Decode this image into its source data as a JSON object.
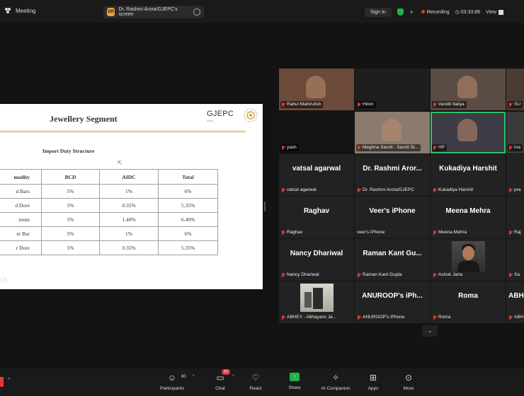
{
  "topbar": {
    "app_title": "Meeting",
    "share_badge": "DR",
    "share_label": "Dr. Rashmi Arora/GJEPC's screen",
    "signin": "Sign In",
    "recording": "Recording",
    "timer": "03:33:89",
    "view": "View"
  },
  "slide": {
    "title": "Jewellery Segment",
    "logo": "GJEPC",
    "logo_sub": "INDIA",
    "subtitle": "Import Duty Structure",
    "table": {
      "headers": [
        "modity",
        "BCD",
        "AIDC",
        "Total"
      ],
      "rows": [
        [
          "d Bars",
          "5%",
          "1%",
          "6%"
        ],
        [
          "d Dore",
          "5%",
          "0.35%",
          "5.35%"
        ],
        [
          "inum",
          "5%",
          "1.40%",
          "6.40%"
        ],
        [
          "er Bar",
          "5%",
          "1%",
          "6%"
        ],
        [
          "r Dore",
          "5%",
          "0.35%",
          "5.35%"
        ]
      ]
    },
    "slide_number": "08"
  },
  "gallery": {
    "video_tiles": [
      {
        "caption": "Rahul Mahirulish",
        "col": 0,
        "row": 0
      },
      {
        "caption": "Hiren",
        "col": 1,
        "row": 0
      },
      {
        "caption": "Vandit Italiya",
        "col": 2,
        "row": 0
      },
      {
        "caption": "SU",
        "col": 3,
        "row": 0
      },
      {
        "caption": "yash",
        "col": 0,
        "row": 1
      },
      {
        "caption": "Meghna Sarott - Sarott St...",
        "col": 1,
        "row": 1
      },
      {
        "caption": "HP",
        "col": 2,
        "row": 1,
        "active": true
      },
      {
        "caption": "ma",
        "col": 3,
        "row": 1
      }
    ],
    "name_tiles": [
      {
        "name": "vatsal agarwal",
        "caption": "vatsal agarwal",
        "col": 0,
        "row": 2,
        "muted": true
      },
      {
        "name": "Dr. Rashmi Aror...",
        "caption": "Dr. Rashmi Arora/GJEPC",
        "col": 1,
        "row": 2,
        "muted": true
      },
      {
        "name": "Kukadiya Harshit",
        "caption": "Kukadiya Harshit",
        "col": 2,
        "row": 2,
        "muted": true
      },
      {
        "name": "",
        "caption": "pra",
        "col": 3,
        "row": 2,
        "muted": true
      },
      {
        "name": "Raghav",
        "caption": "Raghav",
        "col": 0,
        "row": 3,
        "muted": true
      },
      {
        "name": "Veer's iPhone",
        "caption": "veer's iPhone",
        "col": 1,
        "row": 3,
        "muted": false
      },
      {
        "name": "Meena Mehra",
        "caption": "Meena Mehra",
        "col": 2,
        "row": 3,
        "muted": true
      },
      {
        "name": "",
        "caption": "Raj",
        "col": 3,
        "row": 3,
        "muted": true
      },
      {
        "name": "Nancy Dhariwal",
        "caption": "Nancy Dhariwal",
        "col": 0,
        "row": 4,
        "muted": true
      },
      {
        "name": "Raman Kant Gu...",
        "caption": "Raman Kant Gupta",
        "col": 1,
        "row": 4,
        "muted": true
      },
      {
        "name": "",
        "caption": "Ashok Jaria",
        "col": 2,
        "row": 4,
        "muted": true,
        "photo": "person"
      },
      {
        "name": "",
        "caption": "Sa",
        "col": 3,
        "row": 4,
        "muted": true
      },
      {
        "name": "",
        "caption": "ABHEY - Abhayanc Je...",
        "col": 0,
        "row": 5,
        "muted": true,
        "photo": "trees"
      },
      {
        "name": "ANUROOP's iPh...",
        "caption": "ANUROOP's iPhone",
        "col": 1,
        "row": 5,
        "muted": true
      },
      {
        "name": "Roma",
        "caption": "Roma",
        "col": 2,
        "row": 5,
        "muted": true
      },
      {
        "name": "ABH",
        "caption": "ABH",
        "col": 3,
        "row": 5,
        "muted": true
      }
    ]
  },
  "toolbar": {
    "participants_label": "Participants",
    "participants_count": "60",
    "chat_label": "Chat",
    "chat_badge": "22",
    "react_label": "React",
    "share_label": "Share",
    "ai_label": "AI Companion",
    "apps_label": "Apps",
    "more_label": "More"
  }
}
